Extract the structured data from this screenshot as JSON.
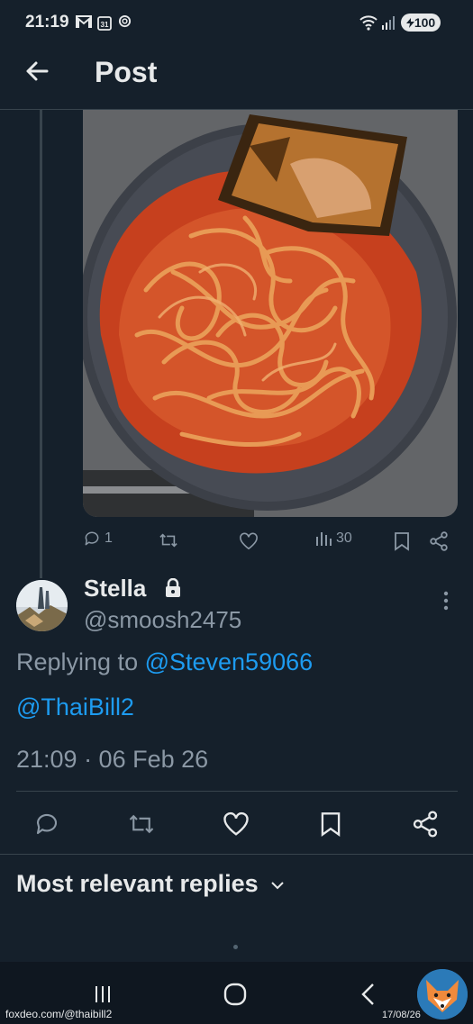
{
  "status_bar": {
    "time": "21:19",
    "notif_icons": [
      "gmail-icon",
      "calendar-icon",
      "threads-icon"
    ],
    "battery": "100"
  },
  "header": {
    "title": "Post"
  },
  "quoted_actions": {
    "replies": "1",
    "views": "30"
  },
  "post": {
    "author_name": "Stella",
    "author_handle": "@smoosh2475",
    "replying_prefix": "Replying to ",
    "replying_to": "@Steven59066",
    "mention": "@ThaiBill2",
    "timestamp": "21:09 · 06 Feb 26"
  },
  "replies_sort": {
    "label": "Most relevant replies"
  },
  "watermark": {
    "left": "foxdeo.com/@thaibill2",
    "right": "17/08/26"
  },
  "colors": {
    "background": "#15202b",
    "accent": "#1d9bf0",
    "muted": "#8b98a5"
  }
}
